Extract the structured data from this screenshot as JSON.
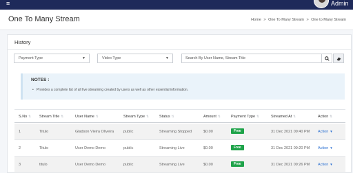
{
  "topbar": {
    "menu_icon": "≡",
    "user_name": "Admin"
  },
  "header": {
    "title": "One To Many Stream",
    "breadcrumb": [
      "Home",
      ">",
      "One To Many Stream",
      ">",
      "One to Many Stream"
    ]
  },
  "card": {
    "title": "History"
  },
  "filters": {
    "payment_type": "Payment Type",
    "video_type": "Video Type",
    "search_placeholder": "Search By User Name, Stream Title",
    "search_icon": "search-icon",
    "clear_icon": "eraser-icon"
  },
  "notes": {
    "title": "NOTES :",
    "items": [
      "Provides a complete list of all live streaming created by users as well as other essential information."
    ]
  },
  "table": {
    "headers": [
      "S.No",
      "Stream Title",
      "User Name",
      "Stream Type",
      "Status",
      "Amount",
      "Payment Type",
      "Streamed At",
      "Action"
    ],
    "rows": [
      {
        "sno": "1",
        "title": "Titulo",
        "user": "Gladson Vieira Oliveira",
        "type": "public",
        "status": "Streaming Stopped",
        "amount": "$0.00",
        "payment": "Free",
        "at": "31 Dec 2021 09:40 PM",
        "action": "Action"
      },
      {
        "sno": "2",
        "title": "Titulo",
        "user": "User Demo Demo",
        "type": "public",
        "status": "Streaming Live",
        "amount": "$0.00",
        "payment": "Free",
        "at": "31 Dec 2021 09:20 PM",
        "action": "Action"
      },
      {
        "sno": "3",
        "title": "titulo",
        "user": "User Demo Demo",
        "type": "public",
        "status": "Streaming Live",
        "amount": "$0.00",
        "payment": "Free",
        "at": "31 Dec 2021 09:26 PM",
        "action": "Action"
      }
    ]
  },
  "colors": {
    "topbar": "#1e2a5a",
    "badge": "#1fa34a",
    "link": "#2a6fd1",
    "notes_bg": "#eaf3fa"
  }
}
